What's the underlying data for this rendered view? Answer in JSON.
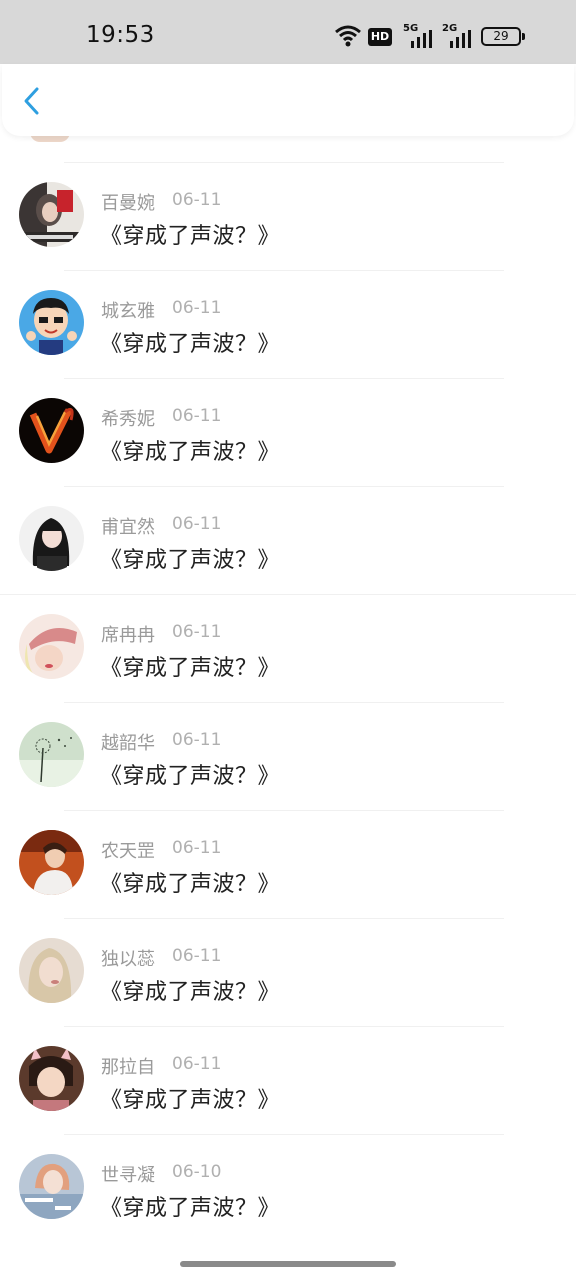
{
  "status_bar": {
    "time": "19:53",
    "battery": "29",
    "hd_label": "HD",
    "signal1_label": "5G",
    "signal2_label": "2G"
  },
  "header": {
    "back_icon": "chevron-left-icon",
    "accent": "#2e9fe0"
  },
  "list": {
    "items": [
      {
        "name": "百曼婉",
        "date": "06-11",
        "title": "《穿成了声波？》"
      },
      {
        "name": "城玄雅",
        "date": "06-11",
        "title": "《穿成了声波？》"
      },
      {
        "name": "希秀妮",
        "date": "06-11",
        "title": "《穿成了声波？》"
      },
      {
        "name": "甫宜然",
        "date": "06-11",
        "title": "《穿成了声波？》"
      },
      {
        "name": "席冉冉",
        "date": "06-11",
        "title": "《穿成了声波？》"
      },
      {
        "name": "越韶华",
        "date": "06-11",
        "title": "《穿成了声波？》"
      },
      {
        "name": "农天罡",
        "date": "06-11",
        "title": "《穿成了声波？》"
      },
      {
        "name": "独以蕊",
        "date": "06-11",
        "title": "《穿成了声波？》"
      },
      {
        "name": "那拉自",
        "date": "06-11",
        "title": "《穿成了声波？》"
      },
      {
        "name": "世寻凝",
        "date": "06-10",
        "title": "《穿成了声波？》"
      }
    ]
  }
}
